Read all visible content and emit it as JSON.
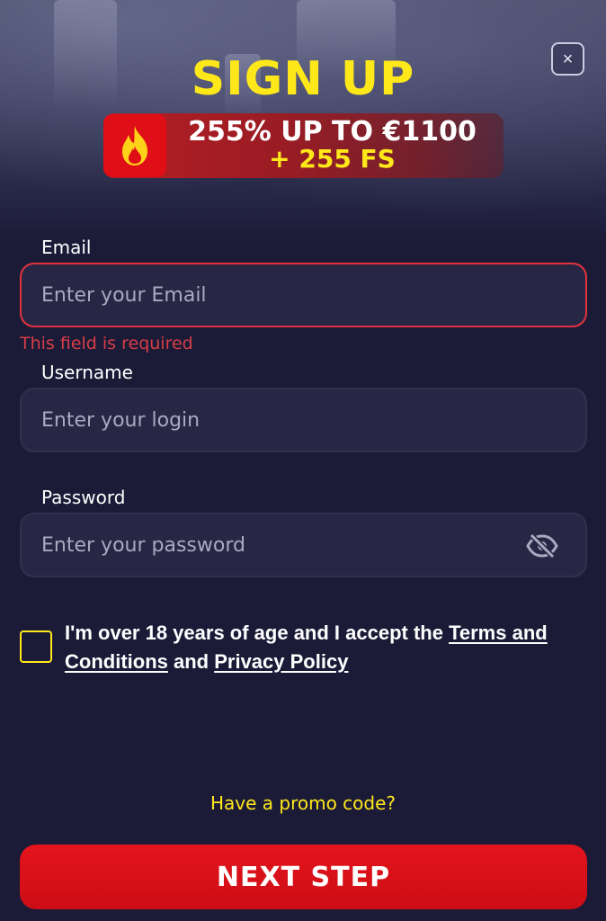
{
  "modal": {
    "title": "SIGN UP",
    "close_label": "×",
    "bonus": {
      "icon": "fire-icon",
      "line1": "255% UP TO €1100",
      "line2": "+ 255 FS"
    }
  },
  "form": {
    "email": {
      "label": "Email",
      "placeholder": "Enter your Email",
      "value": "",
      "error": "This field is required"
    },
    "username": {
      "label": "Username",
      "placeholder": "Enter your login",
      "value": ""
    },
    "password": {
      "label": "Password",
      "placeholder": "Enter your password",
      "value": "",
      "toggle_icon": "eye-slash-icon"
    },
    "consent": {
      "checked": false,
      "text_before": "I'm over 18 years of age and I accept the ",
      "terms_link": "Terms and Conditions",
      "text_middle": " and ",
      "privacy_link": "Privacy Policy"
    },
    "promo_link": "Have a promo code?",
    "submit_label": "NEXT STEP"
  },
  "colors": {
    "background": "#1b1b38",
    "accent_yellow": "#ffe81a",
    "button_red": "#e00f17",
    "error_red": "#d63d45"
  }
}
